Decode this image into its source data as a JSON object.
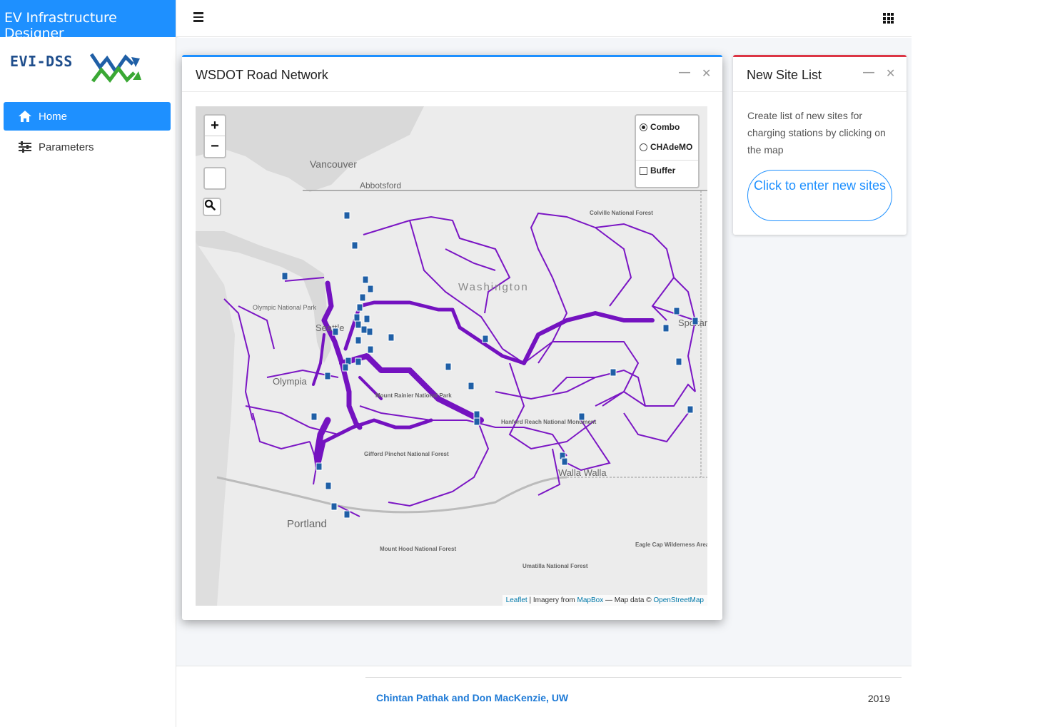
{
  "app": {
    "title": "EV Infrastructure Designer",
    "logo_text": "EVI-DSS"
  },
  "sidebar": {
    "items": [
      {
        "label": "Home",
        "icon": "home-icon",
        "active": true
      },
      {
        "label": "Parameters",
        "icon": "sliders-icon",
        "active": false
      }
    ]
  },
  "map_card": {
    "title": "WSDOT Road Network",
    "zoom_in": "+",
    "zoom_out": "−",
    "layers": [
      {
        "label": "Combo",
        "type": "radio",
        "checked": true
      },
      {
        "label": "CHAdeMO",
        "type": "radio",
        "checked": false
      },
      {
        "label": "Buffer",
        "type": "checkbox",
        "checked": false
      }
    ],
    "place_labels": [
      "Vancouver",
      "Abbotsford",
      "Washington",
      "Seattle",
      "Olympia",
      "Spokane",
      "Walla Walla",
      "Portland",
      "Olympic National Park",
      "Mount Rainier National Park",
      "Gifford Pinchot National Forest",
      "Mount Hood National Forest",
      "Umatilla National Forest",
      "Colville National Forest",
      "Eagle Cap Wilderness Area",
      "Hanford Reach National Monument"
    ],
    "attribution": {
      "leaflet": "Leaflet",
      "imagery": "| Imagery from",
      "mapbox": "MapBox",
      "data": "— Map data ©",
      "osm": "OpenStreetMap"
    },
    "colors": {
      "road": "#7b16c4",
      "major_road": "#7412c0",
      "charger": "#1f5fa6"
    }
  },
  "site_card": {
    "title": "New Site List",
    "description": "Create list of new sites for charging stations by clicking on the map",
    "button": "Click to enter new sites"
  },
  "footer": {
    "authors": "Chintan Pathak and Don MacKenzie, UW",
    "year": "2019"
  }
}
